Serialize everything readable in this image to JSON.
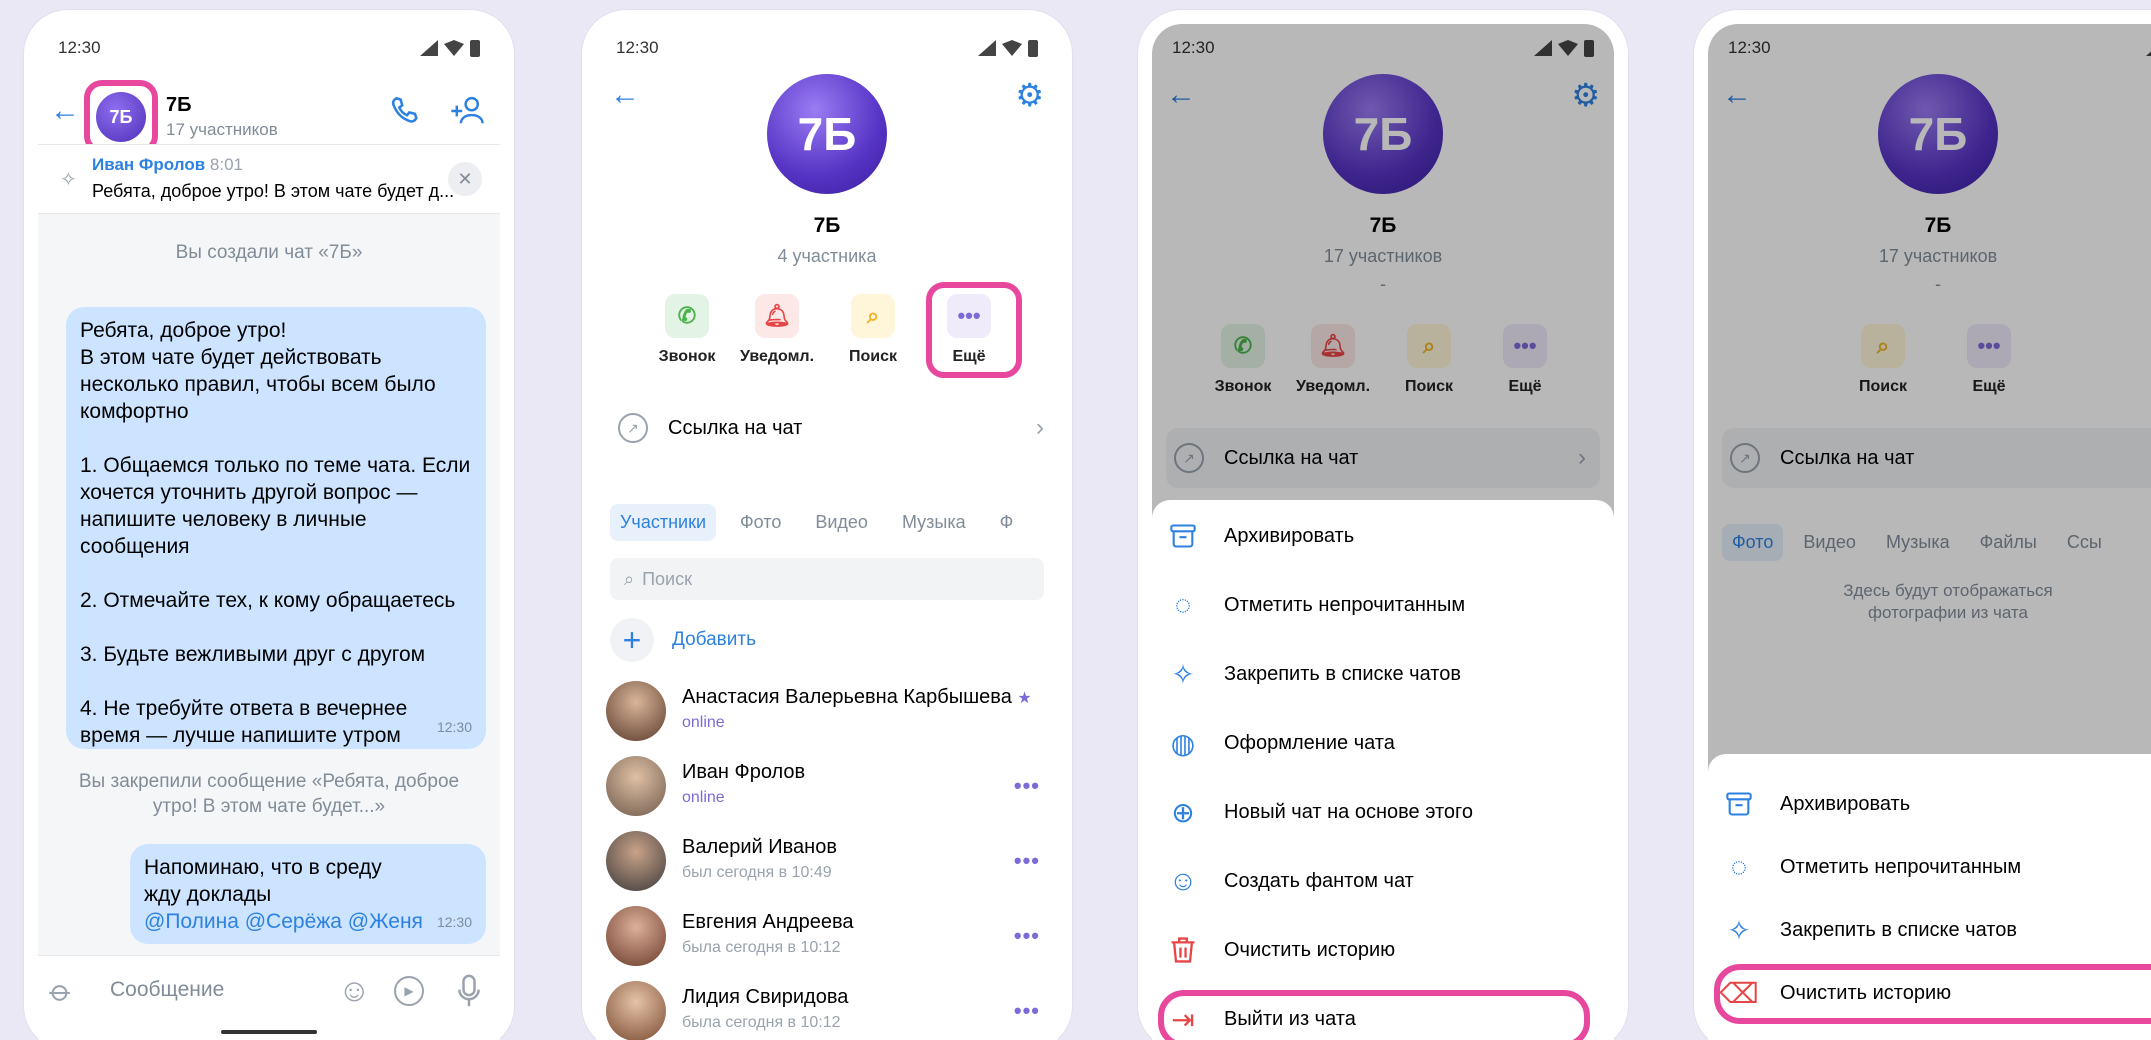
{
  "status": {
    "time": "12:30"
  },
  "chat": {
    "avatar": "7Б",
    "title": "7Б",
    "members": "17 участников",
    "pinned_author": "Иван Фролов",
    "pinned_time": "8:01",
    "pinned_text": "Ребята, доброе утро! В этом чате будет д...",
    "created": "Вы создали чат «7Б»",
    "msg1_lines": [
      "Ребята, доброе утро!",
      "В этом чате будет действовать",
      "несколько правил, чтобы всем было",
      "комфортно",
      "",
      "1. Общаемся только по теме чата. Если",
      "хочется уточнить другой вопрос —",
      "напишите человеку в личные",
      "сообщения",
      "",
      "2. Отмечайте тех, к кому обращаетесь",
      "",
      "3. Будьте вежливыми друг с другом",
      "",
      "4. Не требуйте ответа в вечернее",
      "время — лучше напишите утром"
    ],
    "msg1_time": "12:30",
    "pinned_notice": "Вы закрепили сообщение «Ребята, доброе утро! В этом чате будет...»",
    "msg2_line1": "Напоминаю, что в среду",
    "msg2_line2": "жду доклады",
    "msg2_mentions": "@Полина @Серёжа @Женя",
    "msg2_time": "12:30",
    "composer_placeholder": "Сообщение"
  },
  "profile2": {
    "avatar": "7Б",
    "title": "7Б",
    "members": "4 участника",
    "actions": [
      "Звонок",
      "Уведомл.",
      "Поиск",
      "Ещё"
    ],
    "link": "Ссылка на чат",
    "tabs": [
      "Участники",
      "Фото",
      "Видео",
      "Музыка",
      "Ф"
    ],
    "search_placeholder": "Поиск",
    "add": "Добавить",
    "people": [
      {
        "name": "Анастасия Валерьевна Карбышева",
        "status": "online",
        "star": "★"
      },
      {
        "name": "Иван Фролов",
        "status": "online"
      },
      {
        "name": "Валерий Иванов",
        "status": "был сегодня в 10:49"
      },
      {
        "name": "Евгения Андреева",
        "status": "была сегодня в 10:12"
      },
      {
        "name": "Лидия Свиридова",
        "status": "была сегодня в 10:12"
      }
    ]
  },
  "profile3": {
    "avatar": "7Б",
    "title": "7Б",
    "members": "17 участников",
    "dash": "-",
    "actions": [
      "Звонок",
      "Уведомл.",
      "Поиск",
      "Ещё"
    ],
    "link": "Ссылка на чат",
    "menu": [
      "Архивировать",
      "Отметить непрочитанным",
      "Закрепить в списке чатов",
      "Оформление чата",
      "Новый чат на основе этого",
      "Создать фантом чат",
      "Очистить историю",
      "Выйти из чата"
    ]
  },
  "profile4": {
    "avatar": "7Б",
    "title": "7Б",
    "members": "17 участников",
    "dash": "-",
    "actions": [
      "Поиск",
      "Ещё"
    ],
    "link": "Ссылка на чат",
    "tabs": [
      "Фото",
      "Видео",
      "Музыка",
      "Файлы",
      "Ссы"
    ],
    "empty": "Здесь будут отображаться фотографии из чата",
    "menu": [
      "Архивировать",
      "Отметить непрочитанным",
      "Закрепить в списке чатов",
      "Очистить историю"
    ]
  },
  "colors": {
    "accent": "#2d81e0",
    "highlight": "#e8479e",
    "bubble": "#cce4ff",
    "danger": "#e64646"
  }
}
